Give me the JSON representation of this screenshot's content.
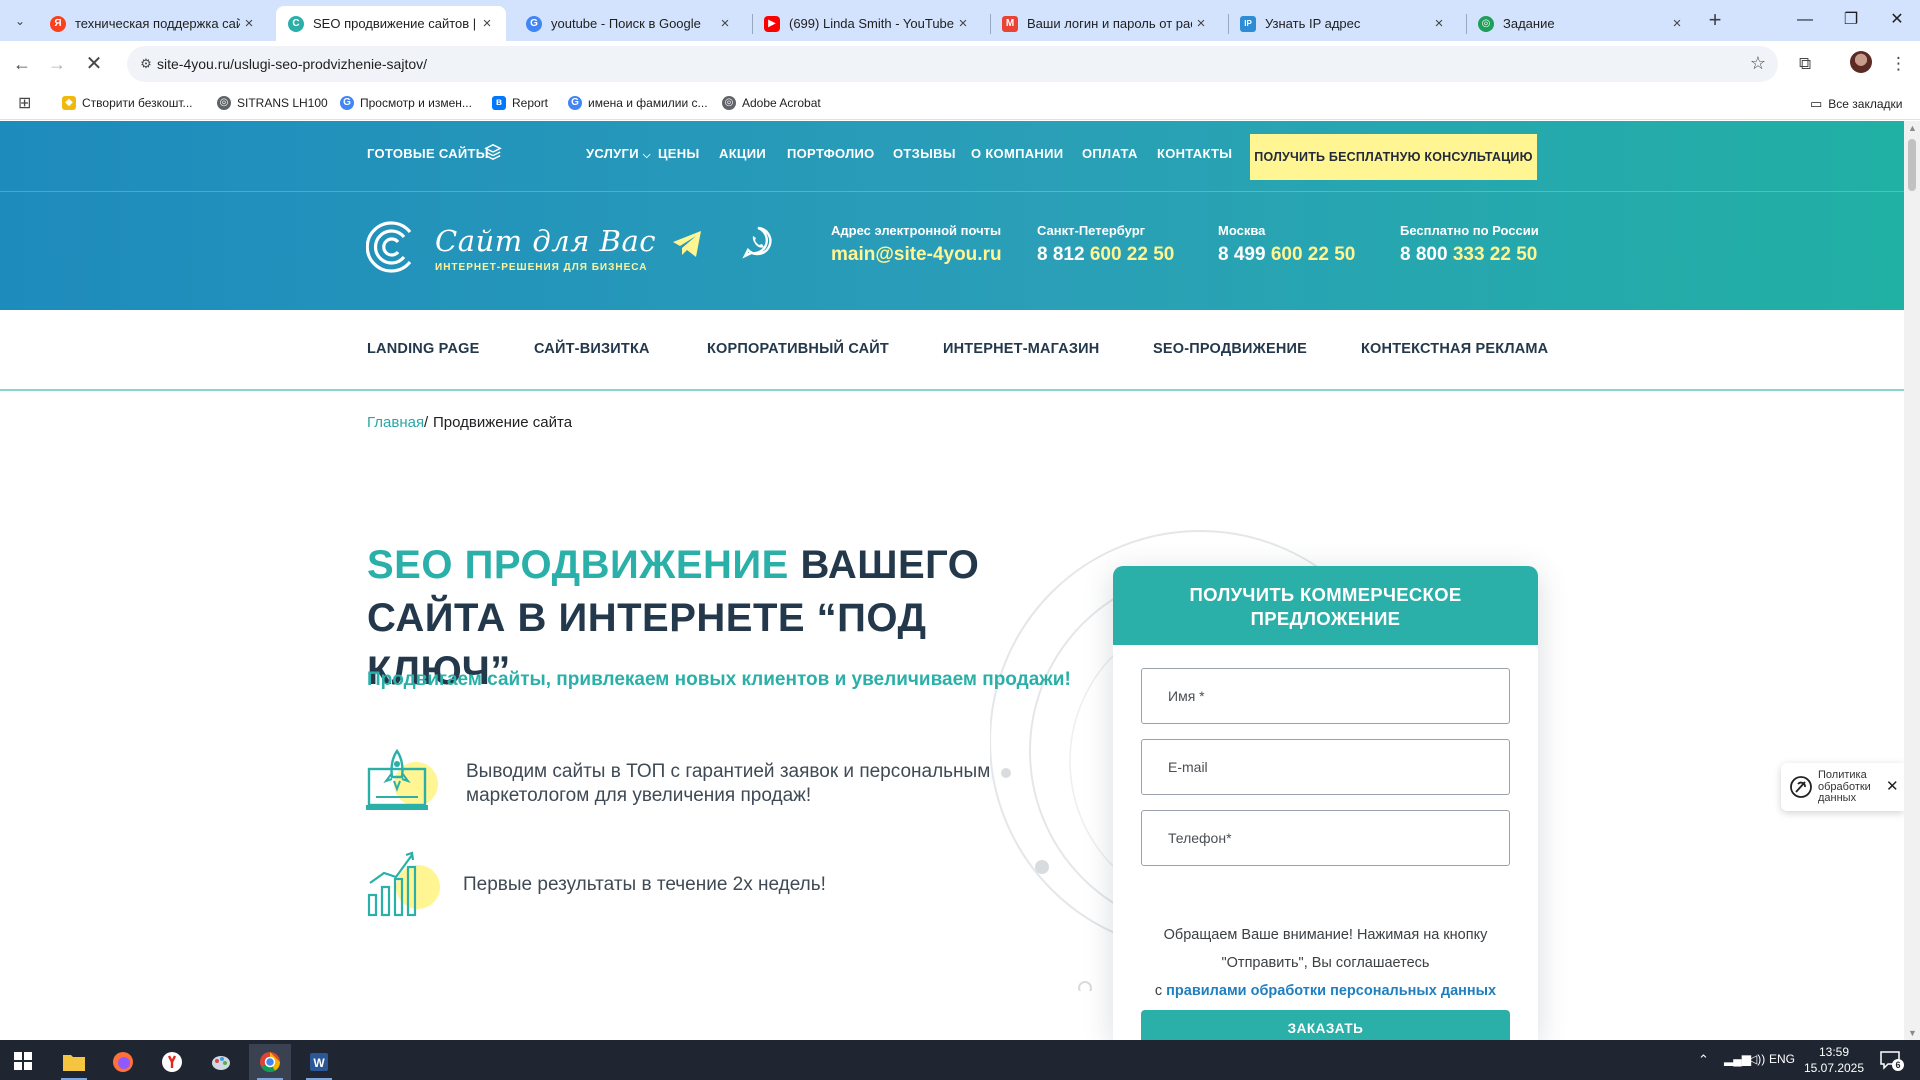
{
  "browser": {
    "tabs": [
      {
        "title": "техническая поддержка сайта",
        "favicon": "yandex-icon",
        "color": "#fc3f1d",
        "glyph": "Я"
      },
      {
        "title": "SEO продвижение сайтов | За",
        "favicon": "site-icon",
        "color": "#2ab0a8",
        "glyph": "C",
        "active": true
      },
      {
        "title": "youtube - Поиск в Google",
        "favicon": "google-icon",
        "color": "#4285f4",
        "glyph": "G"
      },
      {
        "title": "(699) Linda Smith - YouTube",
        "favicon": "youtube-icon",
        "color": "#ff0000",
        "glyph": "▶"
      },
      {
        "title": "Ваши логин и пароль от рас",
        "favicon": "gmail-icon",
        "color": "#ea4335",
        "glyph": "M"
      },
      {
        "title": "Узнать IP адрес",
        "favicon": "ip-icon",
        "color": "#2d8cd6",
        "glyph": "IP"
      },
      {
        "title": "Задание",
        "favicon": "task-icon",
        "color": "#1e9e5a",
        "glyph": "◎"
      }
    ],
    "url": "site-4you.ru/uslugi-seo-prodvizhenie-sajtov/",
    "bookmarks": [
      {
        "label": "Створити безкошт...",
        "icon": "binance-icon",
        "color": "#f0b90b"
      },
      {
        "label": "SITRANS LH100",
        "icon": "globe-icon",
        "color": "#5f6368"
      },
      {
        "label": "Просмотр и измен...",
        "icon": "google-icon",
        "color": "#4285f4"
      },
      {
        "label": "Report",
        "icon": "vk-icon",
        "color": "#0077ff"
      },
      {
        "label": "имена и фамилии с...",
        "icon": "google-icon",
        "color": "#4285f4"
      },
      {
        "label": "Adobe Acrobat",
        "icon": "globe-icon",
        "color": "#5f6368"
      }
    ],
    "all_bookmarks": "Все закладки"
  },
  "site": {
    "top_nav": {
      "ready_sites": "ГОТОВЫЕ САЙТЫ",
      "items": [
        "УСЛУГИ",
        "ЦЕНЫ",
        "АКЦИИ",
        "ПОРТФОЛИО",
        "ОТЗЫВЫ",
        "О КОМПАНИИ",
        "ОПЛАТА",
        "КОНТАКТЫ"
      ],
      "cta": "ПОЛУЧИТЬ БЕСПЛАТНУЮ КОНСУЛЬТАЦИЮ"
    },
    "logo": {
      "name": "Сайт для Вас",
      "tagline": "ИНТЕРНЕТ-РЕШЕНИЯ ДЛЯ БИЗНЕСА"
    },
    "contacts": {
      "email_label": "Адрес электронной почты",
      "email": "main@site-4you.ru",
      "spb_label": "Санкт-Петербург",
      "spb_prefix": "8 812",
      "spb_number": "600 22 50",
      "msk_label": "Москва",
      "msk_prefix": "8 499",
      "msk_number": "600 22 50",
      "free_label": "Бесплатно по России",
      "free_prefix": "8 800",
      "free_number": "333 22 50"
    },
    "category_nav": [
      "LANDING PAGE",
      "САЙТ-ВИЗИТКА",
      "КОРПОРАТИВНЫЙ САЙТ",
      "ИНТЕРНЕТ-МАГАЗИН",
      "SEO-ПРОДВИЖЕНИЕ",
      "КОНТЕКСТНАЯ РЕКЛАМА"
    ],
    "breadcrumb": {
      "home": "Главная",
      "separator": "/",
      "current": "Продвижение сайта"
    },
    "hero": {
      "title_highlight": "SEO ПРОДВИЖЕНИЕ",
      "title_rest": " ВАШЕГО САЙТА В ИНТЕРНЕТЕ “ПОД КЛЮЧ”",
      "subtitle": "Продвигаем сайты, привлекаем новых клиентов и увеличиваем продажи!",
      "features": [
        {
          "icon": "rocket-laptop-icon",
          "text": "Выводим сайты в ТОП с гарантией заявок и персональным маркетологом для увеличения продаж!"
        },
        {
          "icon": "growth-chart-icon",
          "text": "Первые результаты в течение 2х недель!"
        }
      ]
    },
    "form": {
      "title": "ПОЛУЧИТЬ КОММЕРЧЕСКОЕ ПРЕДЛОЖЕНИЕ",
      "name_placeholder": "Имя *",
      "email_placeholder": "E-mail",
      "phone_placeholder": "Телефон*",
      "notice_1": "Обращаем Ваше внимание! Нажимая на кнопку \"Отправить\", Вы соглашаетесь",
      "notice_2": "с",
      "notice_link": "правилами обработки персональных данных",
      "submit": "ЗАКАЗАТЬ"
    },
    "policy_badge": {
      "text": "Политика обработки данных"
    }
  },
  "taskbar": {
    "lang": "ENG",
    "time": "13:59",
    "date": "15.07.2025",
    "notifications": "6"
  },
  "colors": {
    "teal": "#2ab0a8",
    "header_blue": "#1e8bbd",
    "accent_yellow": "#fff592",
    "dark_text": "#24384b"
  }
}
